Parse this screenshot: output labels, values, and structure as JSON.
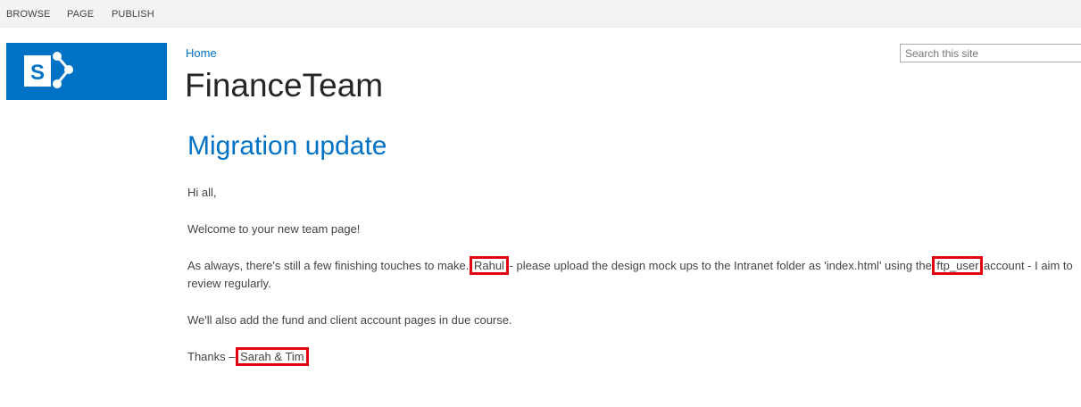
{
  "ribbon": {
    "tabs": [
      {
        "label": "BROWSE"
      },
      {
        "label": "PAGE"
      },
      {
        "label": "PUBLISH"
      }
    ]
  },
  "header": {
    "logo_icon": "sharepoint-logo-icon",
    "breadcrumb": "Home",
    "site_title": "FinanceTeam",
    "search": {
      "placeholder": "Search this site",
      "value": ""
    }
  },
  "colors": {
    "brand": "#0072c6",
    "highlight": "#e3000f"
  },
  "page": {
    "heading": "Migration update",
    "greeting": "Hi all,",
    "welcome": "Welcome to your new team page!",
    "body_part1": "As always, there's still a few finishing touches to make. ",
    "highlight_name": "Rahul",
    "body_part2": " - please upload the design mock ups to the Intranet folder as 'index.html' using the ",
    "highlight_account": "ftp_user",
    "body_part3": " account - I aim to review regularly.",
    "fund_note": "We'll also add the fund and client account pages in due course.",
    "thanks_prefix": "Thanks – ",
    "signoff": "Sarah & Tim"
  }
}
